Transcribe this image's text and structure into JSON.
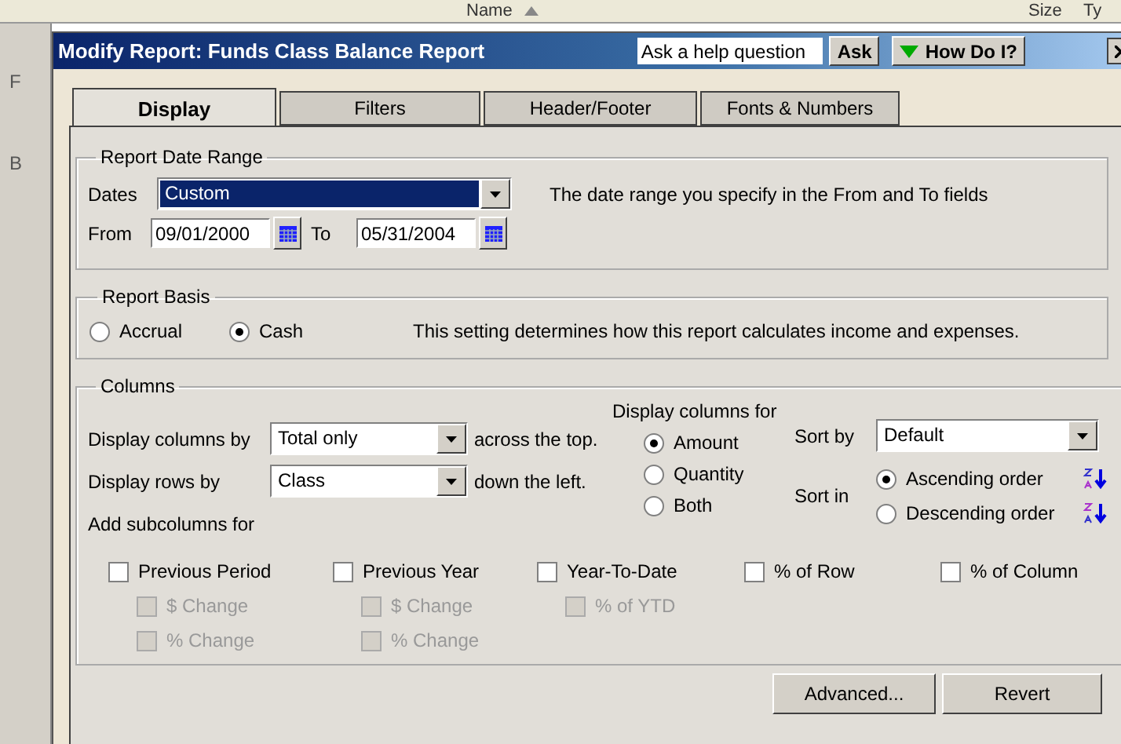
{
  "background_window": {
    "column_headers": [
      {
        "label": "Name",
        "sorted": true
      },
      {
        "label": "Size",
        "sorted": false
      },
      {
        "label": "Ty",
        "sorted": false
      }
    ],
    "side_letters": [
      "F",
      "B"
    ]
  },
  "dialog": {
    "title": "Modify Report: Funds Class Balance Report",
    "help_field": {
      "value": "Ask a help question"
    },
    "ask_button": "Ask",
    "how_button": "How Do I?"
  },
  "tabs": [
    {
      "label": "Display",
      "selected": true
    },
    {
      "label": "Filters",
      "selected": false
    },
    {
      "label": "Header/Footer",
      "selected": false
    },
    {
      "label": "Fonts & Numbers",
      "selected": false
    }
  ],
  "date_range": {
    "title": "Report Date Range",
    "dates_label": "Dates",
    "dates_value": "Custom",
    "hint": "The date range you specify in the From and To fields",
    "from_label": "From",
    "from_value": "09/01/2000",
    "to_label": "To",
    "to_value": "05/31/2004"
  },
  "basis": {
    "title": "Report Basis",
    "options": [
      {
        "label": "Accrual",
        "selected": false
      },
      {
        "label": "Cash",
        "selected": true
      }
    ],
    "hint": "This setting determines how this report calculates income and expenses."
  },
  "columns": {
    "title": "Columns",
    "display_columns_label": "Display columns by",
    "display_columns_value": "Total only",
    "display_columns_suffix": "across the top.",
    "display_rows_label": "Display rows by",
    "display_rows_value": "Class",
    "display_rows_suffix": "down the left.",
    "display_for_label": "Display columns for",
    "display_for_options": [
      {
        "label": "Amount",
        "selected": true
      },
      {
        "label": "Quantity",
        "selected": false
      },
      {
        "label": "Both",
        "selected": false
      }
    ],
    "sort_by_label": "Sort by",
    "sort_by_value": "Default",
    "sort_in_label": "Sort in",
    "sort_in_options": [
      {
        "label": "Ascending order",
        "selected": true,
        "kind": "ascending"
      },
      {
        "label": "Descending order",
        "selected": false,
        "kind": "descending"
      }
    ],
    "subcolumns_label": "Add subcolumns for",
    "subcolumns": [
      {
        "label": "Previous Period",
        "checked": false,
        "disabled": false,
        "children": [
          {
            "label": "$ Change",
            "checked": false,
            "disabled": true
          },
          {
            "label": "% Change",
            "checked": false,
            "disabled": true
          }
        ]
      },
      {
        "label": "Previous Year",
        "checked": false,
        "disabled": false,
        "children": [
          {
            "label": "$ Change",
            "checked": false,
            "disabled": true
          },
          {
            "label": "% Change",
            "checked": false,
            "disabled": true
          }
        ]
      },
      {
        "label": "Year-To-Date",
        "checked": false,
        "disabled": false,
        "children": [
          {
            "label": "% of YTD",
            "checked": false,
            "disabled": true
          }
        ]
      },
      {
        "label": "% of Row",
        "checked": false,
        "disabled": false
      },
      {
        "label": "% of Column",
        "checked": false,
        "disabled": false
      }
    ]
  },
  "buttons": [
    "Advanced...",
    "Revert"
  ]
}
